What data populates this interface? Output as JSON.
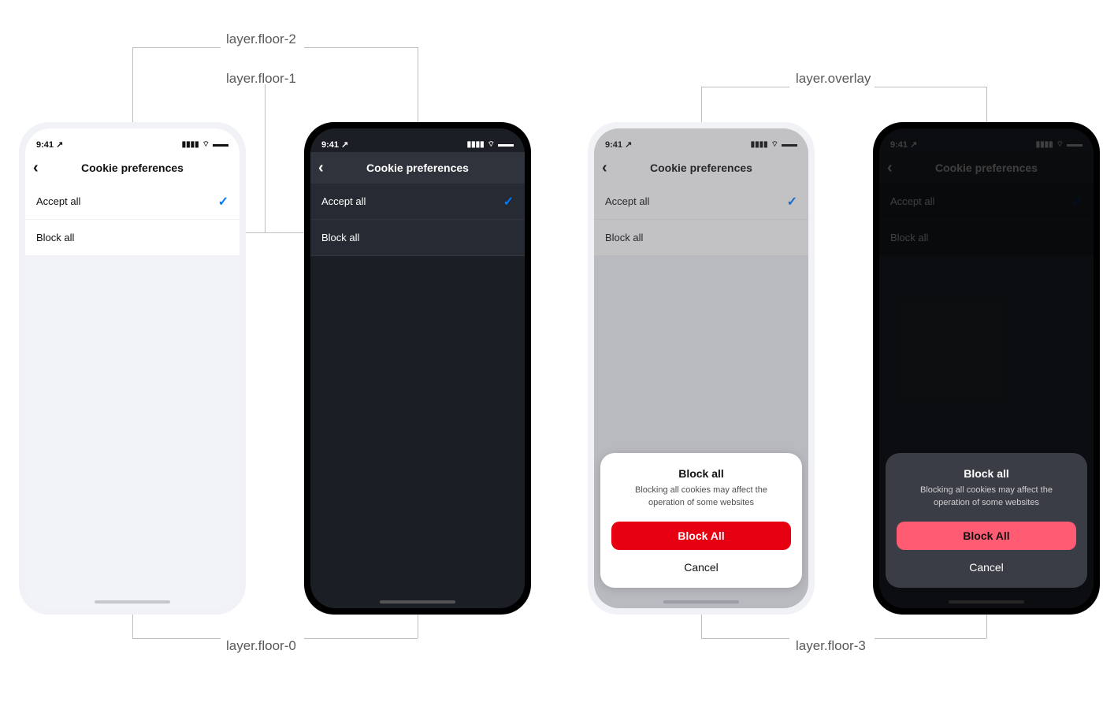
{
  "labels": {
    "floor2": "layer.floor-2",
    "floor1": "layer.floor-1",
    "floor0": "layer.floor-0",
    "floor3": "layer.floor-3",
    "overlay": "layer.overlay"
  },
  "status": {
    "time": "9:41",
    "nav_arrow": "↗︎"
  },
  "nav": {
    "title": "Cookie preferences",
    "back_glyph": "‹"
  },
  "rows": {
    "accept": "Accept all",
    "block": "Block all",
    "check": "✓"
  },
  "sheet": {
    "title": "Block all",
    "subtitle": "Blocking all cookies may affect the operation of some websites",
    "primary": "Block All",
    "cancel": "Cancel"
  },
  "colors": {
    "accent": "#007aff",
    "danger_light": "#e60012",
    "danger_dark": "#ff5b72"
  }
}
